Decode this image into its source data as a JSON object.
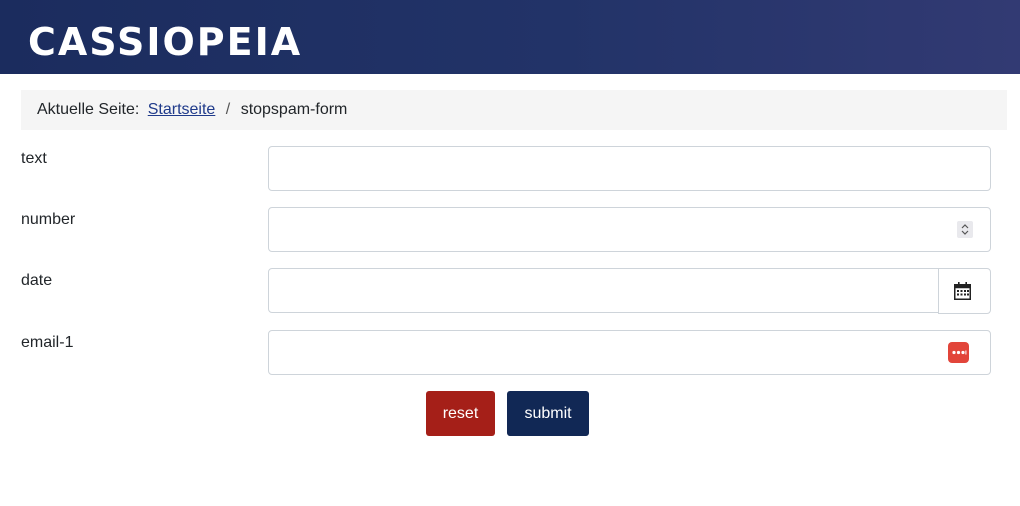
{
  "header": {
    "brand": "CASSIOPEIA"
  },
  "breadcrumb": {
    "prefix": "Aktuelle Seite:",
    "home_label": "Startseite",
    "separator": "/",
    "current": "stopspam-form"
  },
  "form": {
    "fields": [
      {
        "label": "text",
        "value": ""
      },
      {
        "label": "number",
        "value": ""
      },
      {
        "label": "date",
        "value": ""
      },
      {
        "label": "email-1",
        "value": ""
      }
    ],
    "reset_label": "reset",
    "submit_label": "submit"
  },
  "colors": {
    "header_start": "#1b2c5e",
    "header_end": "#323a73",
    "link": "#1f3a8a",
    "reset_button": "#a51f18",
    "submit_button": "#112855",
    "password_manager_icon": "#e2453a"
  },
  "icons": {
    "number_field": "spinner-icon",
    "date_field": "calendar-icon",
    "email_field": "password-manager-icon"
  }
}
